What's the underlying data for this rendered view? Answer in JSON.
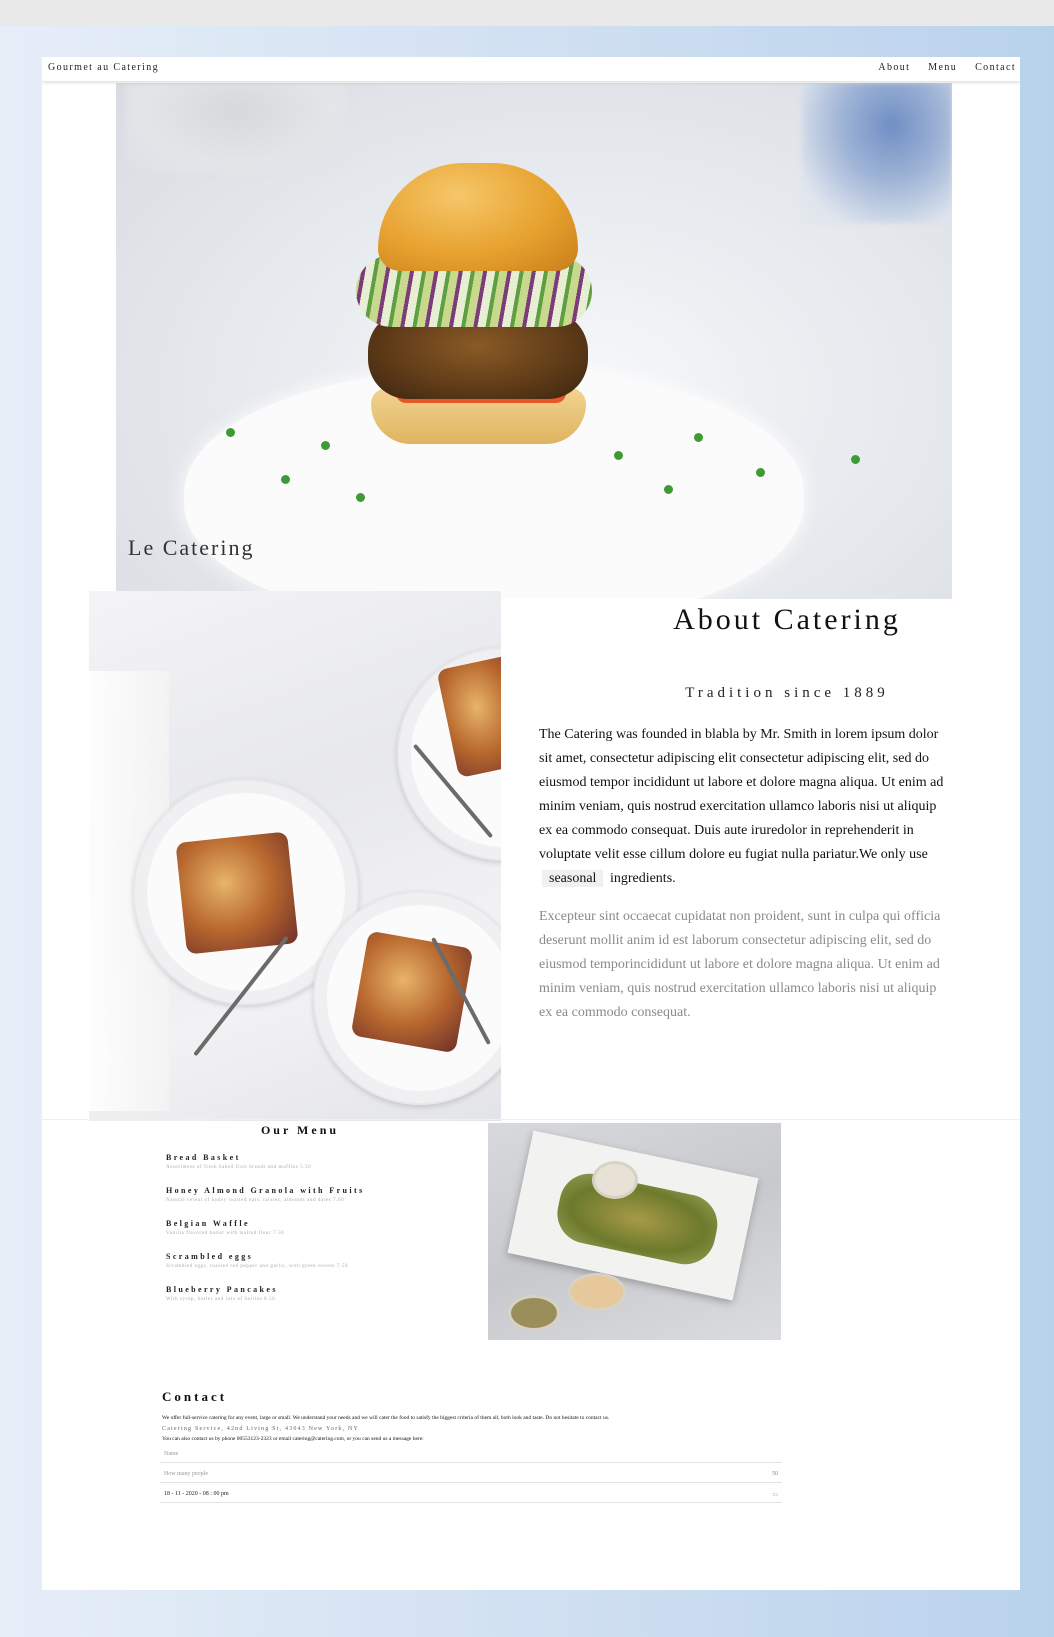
{
  "nav": {
    "brand": "Gourmet au Catering",
    "links": [
      "About",
      "Menu",
      "Contact"
    ]
  },
  "hero": {
    "title": "Le Catering"
  },
  "about": {
    "title": "About Catering",
    "subtitle": "Tradition since 1889",
    "p1_before": "The Catering was founded in blabla by Mr. Smith in lorem ipsum dolor sit amet, consectetur adipiscing elit consectetur adipiscing elit, sed do eiusmod tempor incididunt ut labore et dolore magna aliqua. Ut enim ad minim veniam, quis nostrud exercitation ullamco laboris nisi ut aliquip ex ea commodo consequat. Duis aute iruredolor in reprehenderit in voluptate velit esse cillum dolore eu fugiat nulla pariatur.We only use",
    "p1_highlight": "seasonal",
    "p1_after": "ingredients.",
    "p2": "Excepteur sint occaecat cupidatat non proident, sunt in culpa qui officia deserunt mollit anim id est laborum consectetur adipiscing elit, sed do eiusmod temporincididunt ut labore et dolore magna aliqua. Ut enim ad minim veniam, quis nostrud exercitation ullamco laboris nisi ut aliquip ex ea commodo consequat."
  },
  "menu": {
    "title": "Our Menu",
    "items": [
      {
        "name": "Bread Basket",
        "desc": "Assortment of fresh baked fruit breads and muffins 5.50"
      },
      {
        "name": "Honey Almond Granola with Fruits",
        "desc": "Natural cereal of honey toasted oats, raisins, almonds and dates 7.00"
      },
      {
        "name": "Belgian Waffle",
        "desc": "Vanilla flavored batter with malted flour 7.50"
      },
      {
        "name": "Scrambled eggs",
        "desc": "Scrambled eggs, roasted red pepper and garlic, with green onions 7.50"
      },
      {
        "name": "Blueberry Pancakes",
        "desc": "With syrup, butter and lots of berries 8.50"
      }
    ]
  },
  "contact": {
    "title": "Contact",
    "intro": "We offer full-service catering for any event, large or small. We understand your needs and we will cater the food to satisfy the biggest criteria of them all, both look and taste. Do not hesitate to contact us.",
    "address": "Catering Service, 42nd Living St, 43043 New York, NY",
    "phone_line": "You can also contact us by phone 00553123-2323 or email catering@catering.com, or you can send us a message here:",
    "name_placeholder": "Name",
    "people_placeholder": "How many people",
    "people_suffix": "50",
    "date_value": "18 - 11 - 2020 - 08 : 00  pm",
    "date_icon": "calendar-icon"
  }
}
